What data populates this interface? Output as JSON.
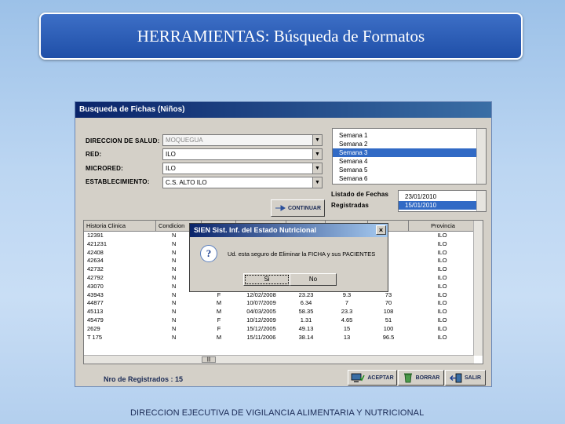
{
  "slide": {
    "title": "HERRAMIENTAS: Búsqueda de Formatos",
    "footer": "DIRECCION EJECUTIVA DE VIGILANCIA ALIMENTARIA Y NUTRICIONAL"
  },
  "window": {
    "title": "Busqueda de Fichas (Niños)",
    "fields": [
      {
        "label": "DIRECCION DE SALUD:",
        "value": "MOQUEGUA",
        "disabled": true
      },
      {
        "label": "RED:",
        "value": "ILO",
        "disabled": false
      },
      {
        "label": "MICRORED:",
        "value": "ILO",
        "disabled": false
      },
      {
        "label": "ESTABLECIMIENTO:",
        "value": "C.S. ALTO ILO",
        "disabled": false
      }
    ],
    "semanas": [
      "Semana 1",
      "Semana 2",
      "Semana 3",
      "Semana 4",
      "Semana 5",
      "Semana 6"
    ],
    "semana_selected": 2,
    "fechas_label_1": "Listado de Fechas",
    "fechas_label_2": "Registradas",
    "fechas": [
      "23/01/2010",
      "15/01/2010"
    ],
    "fecha_selected": 1,
    "continuar_label": "CONTINUAR",
    "grid_headers": [
      "Historia Clinica",
      "Condicion",
      "",
      "",
      "",
      "",
      "",
      "Provincia"
    ],
    "grid_rows": [
      [
        "12391",
        "N",
        "",
        "",
        "",
        "",
        "",
        "ILO"
      ],
      [
        "421231",
        "N",
        "",
        "",
        "",
        "",
        "",
        "ILO"
      ],
      [
        "42408",
        "N",
        "",
        "",
        "",
        "",
        "",
        "ILO"
      ],
      [
        "42634",
        "N",
        "",
        "",
        "",
        "",
        "",
        "ILO"
      ],
      [
        "42732",
        "N",
        "",
        "",
        "",
        "",
        "",
        "ILO"
      ],
      [
        "42792",
        "N",
        "",
        "",
        "",
        "",
        "",
        "ILO"
      ],
      [
        "43070",
        "N",
        "",
        "",
        "",
        "",
        "",
        "ILO"
      ],
      [
        "43943",
        "N",
        "F",
        "12/02/2008",
        "23.23",
        "9.3",
        "73",
        "ILO"
      ],
      [
        "44877",
        "N",
        "M",
        "10/07/2009",
        "6.34",
        "7",
        "70",
        "ILO"
      ],
      [
        "45113",
        "N",
        "M",
        "04/03/2005",
        "58.35",
        "23.3",
        "108",
        "ILO"
      ],
      [
        "45479",
        "N",
        "F",
        "10/12/2009",
        "1.31",
        "4.65",
        "51",
        "ILO"
      ],
      [
        "2629",
        "N",
        "F",
        "15/12/2005",
        "49.13",
        "15",
        "100",
        "ILO"
      ],
      [
        "T 175",
        "N",
        "M",
        "15/11/2006",
        "38.14",
        "13",
        "96.5",
        "ILO"
      ]
    ],
    "record_count_text": "Nro de Registrados : 15",
    "buttons": {
      "aceptar": "ACEPTAR",
      "borrar": "BORRAR",
      "salir": "SALIR"
    }
  },
  "dialog": {
    "title": "SIEN Sist. Inf. del Estado Nutricional",
    "message": "Ud. esta seguro de Eliminar la FICHA y sus PACIENTES",
    "yes": "Si",
    "no": "No"
  }
}
